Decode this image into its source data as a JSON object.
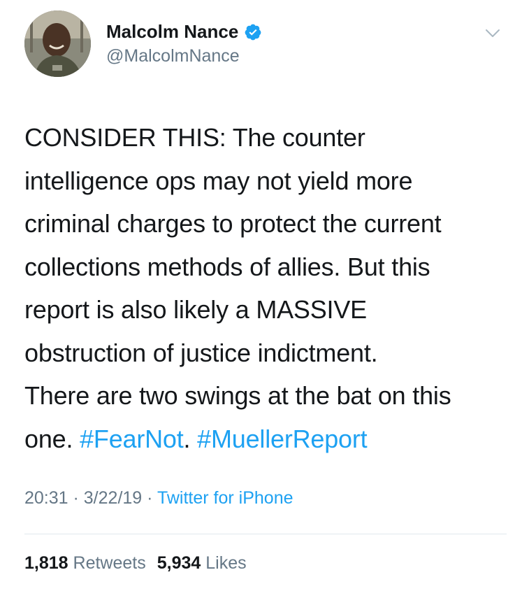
{
  "author": {
    "display_name": "Malcolm Nance",
    "handle": "@MalcolmNance",
    "verified": true
  },
  "tweet": {
    "lines": [
      "CONSIDER THIS: The counter",
      "intelligence ops may not yield more",
      "criminal charges to protect the current",
      "collections methods of allies. But this",
      "report is also likely a MASSIVE",
      "obstruction of justice indictment.",
      "There are two swings at the bat on this"
    ],
    "last_line_prefix": "one. ",
    "hashtag_1": "#FearNot",
    "hashtag_separator": ". ",
    "hashtag_2": "#MuellerReport"
  },
  "meta": {
    "time": "20:31",
    "separator": " · ",
    "date": "3/22/19",
    "source": "Twitter for iPhone"
  },
  "stats": {
    "retweets_count": "1,818",
    "retweets_label": "Retweets",
    "likes_count": "5,934",
    "likes_label": "Likes"
  },
  "colors": {
    "link": "#1da1f2",
    "secondary_text": "#657786",
    "primary_text": "#14171a",
    "divider": "#e1e8ed"
  },
  "icons": {
    "verified": "verified-badge-icon",
    "menu": "chevron-down-icon"
  }
}
